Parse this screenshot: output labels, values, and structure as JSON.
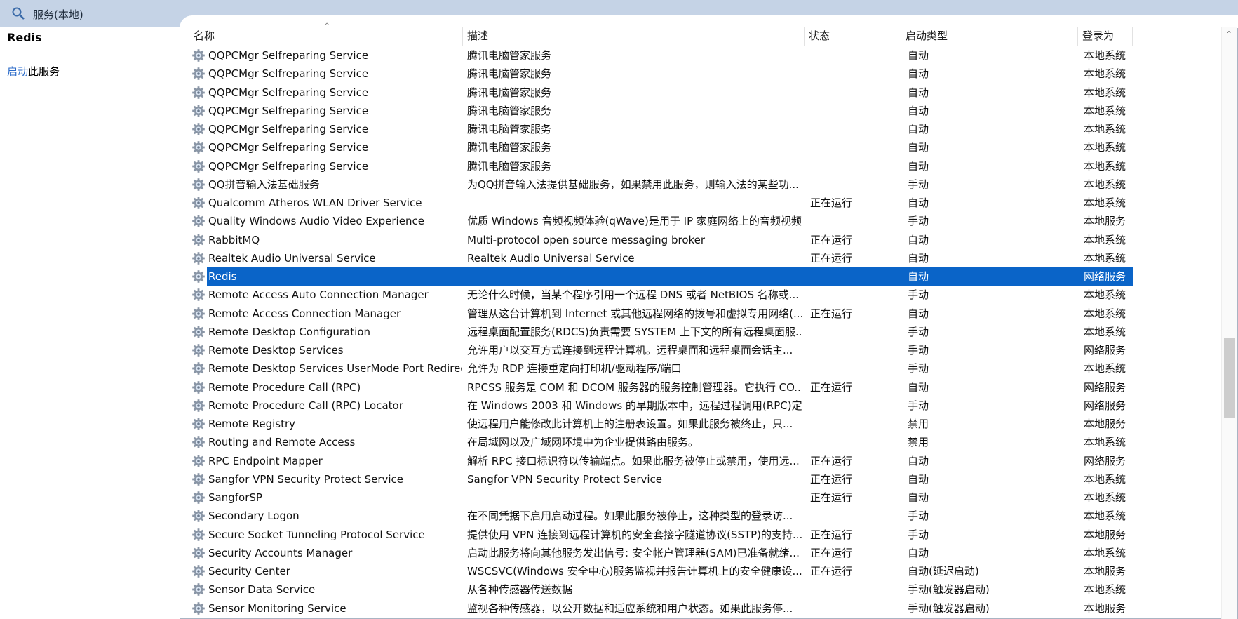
{
  "window": {
    "title": "服务(本地)"
  },
  "left_pane": {
    "service_name": "Redis",
    "start_link": "启动",
    "start_suffix": "此服务"
  },
  "columns": [
    "名称",
    "描述",
    "状态",
    "启动类型",
    "登录为"
  ],
  "rows": [
    {
      "name": "QQPCMgr Selfreparing Service",
      "desc": "腾讯电脑管家服务",
      "status": "",
      "startup": "自动",
      "logon": "本地系统"
    },
    {
      "name": "QQPCMgr Selfreparing Service",
      "desc": "腾讯电脑管家服务",
      "status": "",
      "startup": "自动",
      "logon": "本地系统"
    },
    {
      "name": "QQPCMgr Selfreparing Service",
      "desc": "腾讯电脑管家服务",
      "status": "",
      "startup": "自动",
      "logon": "本地系统"
    },
    {
      "name": "QQPCMgr Selfreparing Service",
      "desc": "腾讯电脑管家服务",
      "status": "",
      "startup": "自动",
      "logon": "本地系统"
    },
    {
      "name": "QQPCMgr Selfreparing Service",
      "desc": "腾讯电脑管家服务",
      "status": "",
      "startup": "自动",
      "logon": "本地系统"
    },
    {
      "name": "QQPCMgr Selfreparing Service",
      "desc": "腾讯电脑管家服务",
      "status": "",
      "startup": "自动",
      "logon": "本地系统"
    },
    {
      "name": "QQPCMgr Selfreparing Service",
      "desc": "腾讯电脑管家服务",
      "status": "",
      "startup": "自动",
      "logon": "本地系统"
    },
    {
      "name": "QQ拼音输入法基础服务",
      "desc": "为QQ拼音输入法提供基础服务，如果禁用此服务，则输入法的某些功...",
      "status": "",
      "startup": "手动",
      "logon": "本地系统"
    },
    {
      "name": "Qualcomm Atheros WLAN Driver Service",
      "desc": "",
      "status": "正在运行",
      "startup": "自动",
      "logon": "本地系统"
    },
    {
      "name": "Quality Windows Audio Video Experience",
      "desc": "优质 Windows 音频视频体验(qWave)是用于 IP 家庭网络上的音频视频...",
      "status": "",
      "startup": "手动",
      "logon": "本地服务"
    },
    {
      "name": "RabbitMQ",
      "desc": "Multi-protocol open source messaging broker",
      "status": "正在运行",
      "startup": "自动",
      "logon": "本地系统"
    },
    {
      "name": "Realtek Audio Universal Service",
      "desc": "Realtek Audio Universal Service",
      "status": "正在运行",
      "startup": "自动",
      "logon": "本地系统"
    },
    {
      "name": "Redis",
      "desc": "",
      "status": "",
      "startup": "自动",
      "logon": "网络服务",
      "selected": true
    },
    {
      "name": "Remote Access Auto Connection Manager",
      "desc": "无论什么时候，当某个程序引用一个远程 DNS 或者 NetBIOS 名称或...",
      "status": "",
      "startup": "手动",
      "logon": "本地系统"
    },
    {
      "name": "Remote Access Connection Manager",
      "desc": "管理从这台计算机到 Internet 或其他远程网络的拨号和虚拟专用网络(...",
      "status": "正在运行",
      "startup": "自动",
      "logon": "本地系统"
    },
    {
      "name": "Remote Desktop Configuration",
      "desc": "远程桌面配置服务(RDCS)负责需要 SYSTEM 上下文的所有远程桌面服...",
      "status": "",
      "startup": "手动",
      "logon": "本地系统"
    },
    {
      "name": "Remote Desktop Services",
      "desc": "允许用户以交互方式连接到远程计算机。远程桌面和远程桌面会话主...",
      "status": "",
      "startup": "手动",
      "logon": "网络服务"
    },
    {
      "name": "Remote Desktop Services UserMode Port Redirector",
      "desc": "允许为 RDP 连接重定向打印机/驱动程序/端口",
      "status": "",
      "startup": "手动",
      "logon": "本地系统"
    },
    {
      "name": "Remote Procedure Call (RPC)",
      "desc": "RPCSS 服务是 COM 和 DCOM 服务器的服务控制管理器。它执行 CO...",
      "status": "正在运行",
      "startup": "自动",
      "logon": "网络服务"
    },
    {
      "name": "Remote Procedure Call (RPC) Locator",
      "desc": "在 Windows 2003 和 Windows 的早期版本中，远程过程调用(RPC)定...",
      "status": "",
      "startup": "手动",
      "logon": "网络服务"
    },
    {
      "name": "Remote Registry",
      "desc": "使远程用户能修改此计算机上的注册表设置。如果此服务被终止，只...",
      "status": "",
      "startup": "禁用",
      "logon": "本地服务"
    },
    {
      "name": "Routing and Remote Access",
      "desc": "在局域网以及广域网环境中为企业提供路由服务。",
      "status": "",
      "startup": "禁用",
      "logon": "本地系统"
    },
    {
      "name": "RPC Endpoint Mapper",
      "desc": "解析 RPC 接口标识符以传输端点。如果此服务被停止或禁用，使用远...",
      "status": "正在运行",
      "startup": "自动",
      "logon": "网络服务"
    },
    {
      "name": "Sangfor VPN Security Protect Service",
      "desc": "Sangfor VPN Security Protect Service",
      "status": "正在运行",
      "startup": "自动",
      "logon": "本地系统"
    },
    {
      "name": "SangforSP",
      "desc": "",
      "status": "正在运行",
      "startup": "自动",
      "logon": "本地系统"
    },
    {
      "name": "Secondary Logon",
      "desc": "在不同凭据下启用启动过程。如果此服务被停止，这种类型的登录访...",
      "status": "",
      "startup": "手动",
      "logon": "本地系统"
    },
    {
      "name": "Secure Socket Tunneling Protocol Service",
      "desc": "提供使用 VPN 连接到远程计算机的安全套接字隧道协议(SSTP)的支持...",
      "status": "正在运行",
      "startup": "手动",
      "logon": "本地服务"
    },
    {
      "name": "Security Accounts Manager",
      "desc": "启动此服务将向其他服务发出信号: 安全帐户管理器(SAM)已准备就绪...",
      "status": "正在运行",
      "startup": "自动",
      "logon": "本地系统"
    },
    {
      "name": "Security Center",
      "desc": "WSCSVC(Windows 安全中心)服务监视并报告计算机上的安全健康设...",
      "status": "正在运行",
      "startup": "自动(延迟启动)",
      "logon": "本地服务"
    },
    {
      "name": "Sensor Data Service",
      "desc": "从各种传感器传送数据",
      "status": "",
      "startup": "手动(触发器启动)",
      "logon": "本地系统"
    },
    {
      "name": "Sensor Monitoring Service",
      "desc": "监视各种传感器，以公开数据和适应系统和用户状态。如果此服务停...",
      "status": "",
      "startup": "手动(触发器启动)",
      "logon": "本地服务"
    }
  ]
}
